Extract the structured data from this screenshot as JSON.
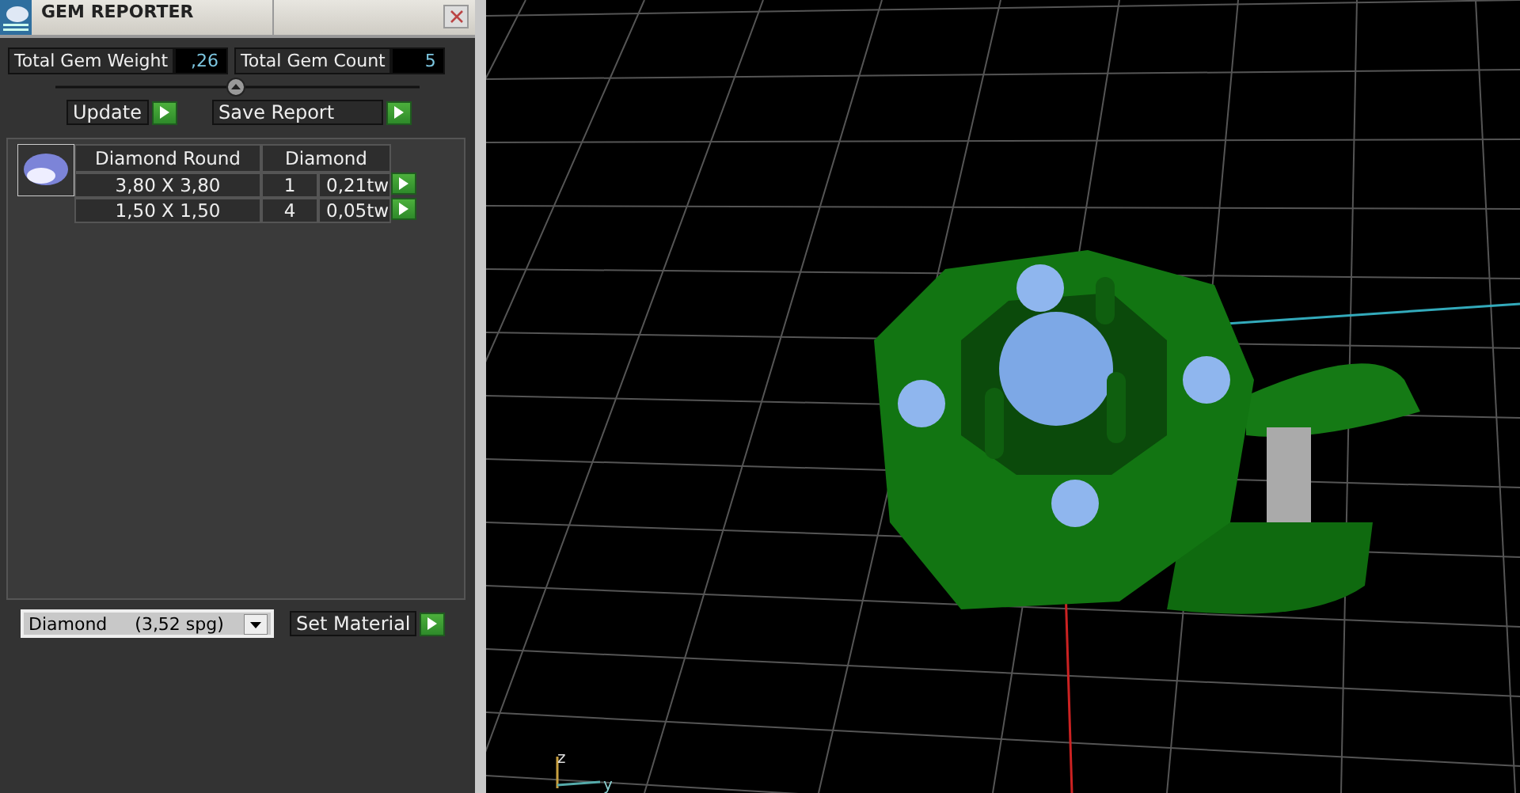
{
  "window": {
    "title": "GEM REPORTER"
  },
  "totals": [
    {
      "label": "Total Gem Weight",
      "value": ",26"
    },
    {
      "label": "Total Gem Count",
      "value": "5"
    }
  ],
  "actions": [
    "Update",
    "Save Report"
  ],
  "gem_table": {
    "columns": [
      "Diamond Round",
      "Diamond"
    ],
    "rows": [
      {
        "size": "3,80 X 3,80",
        "count": "1",
        "weight": "0,21tw"
      },
      {
        "size": "1,50 X 1,50",
        "count": "4",
        "weight": "0,05tw"
      }
    ]
  },
  "material": {
    "value": "Diamond     (3,52 spg)",
    "button": "Set Material"
  },
  "viewport": {
    "axes": [
      "z",
      "y"
    ]
  }
}
